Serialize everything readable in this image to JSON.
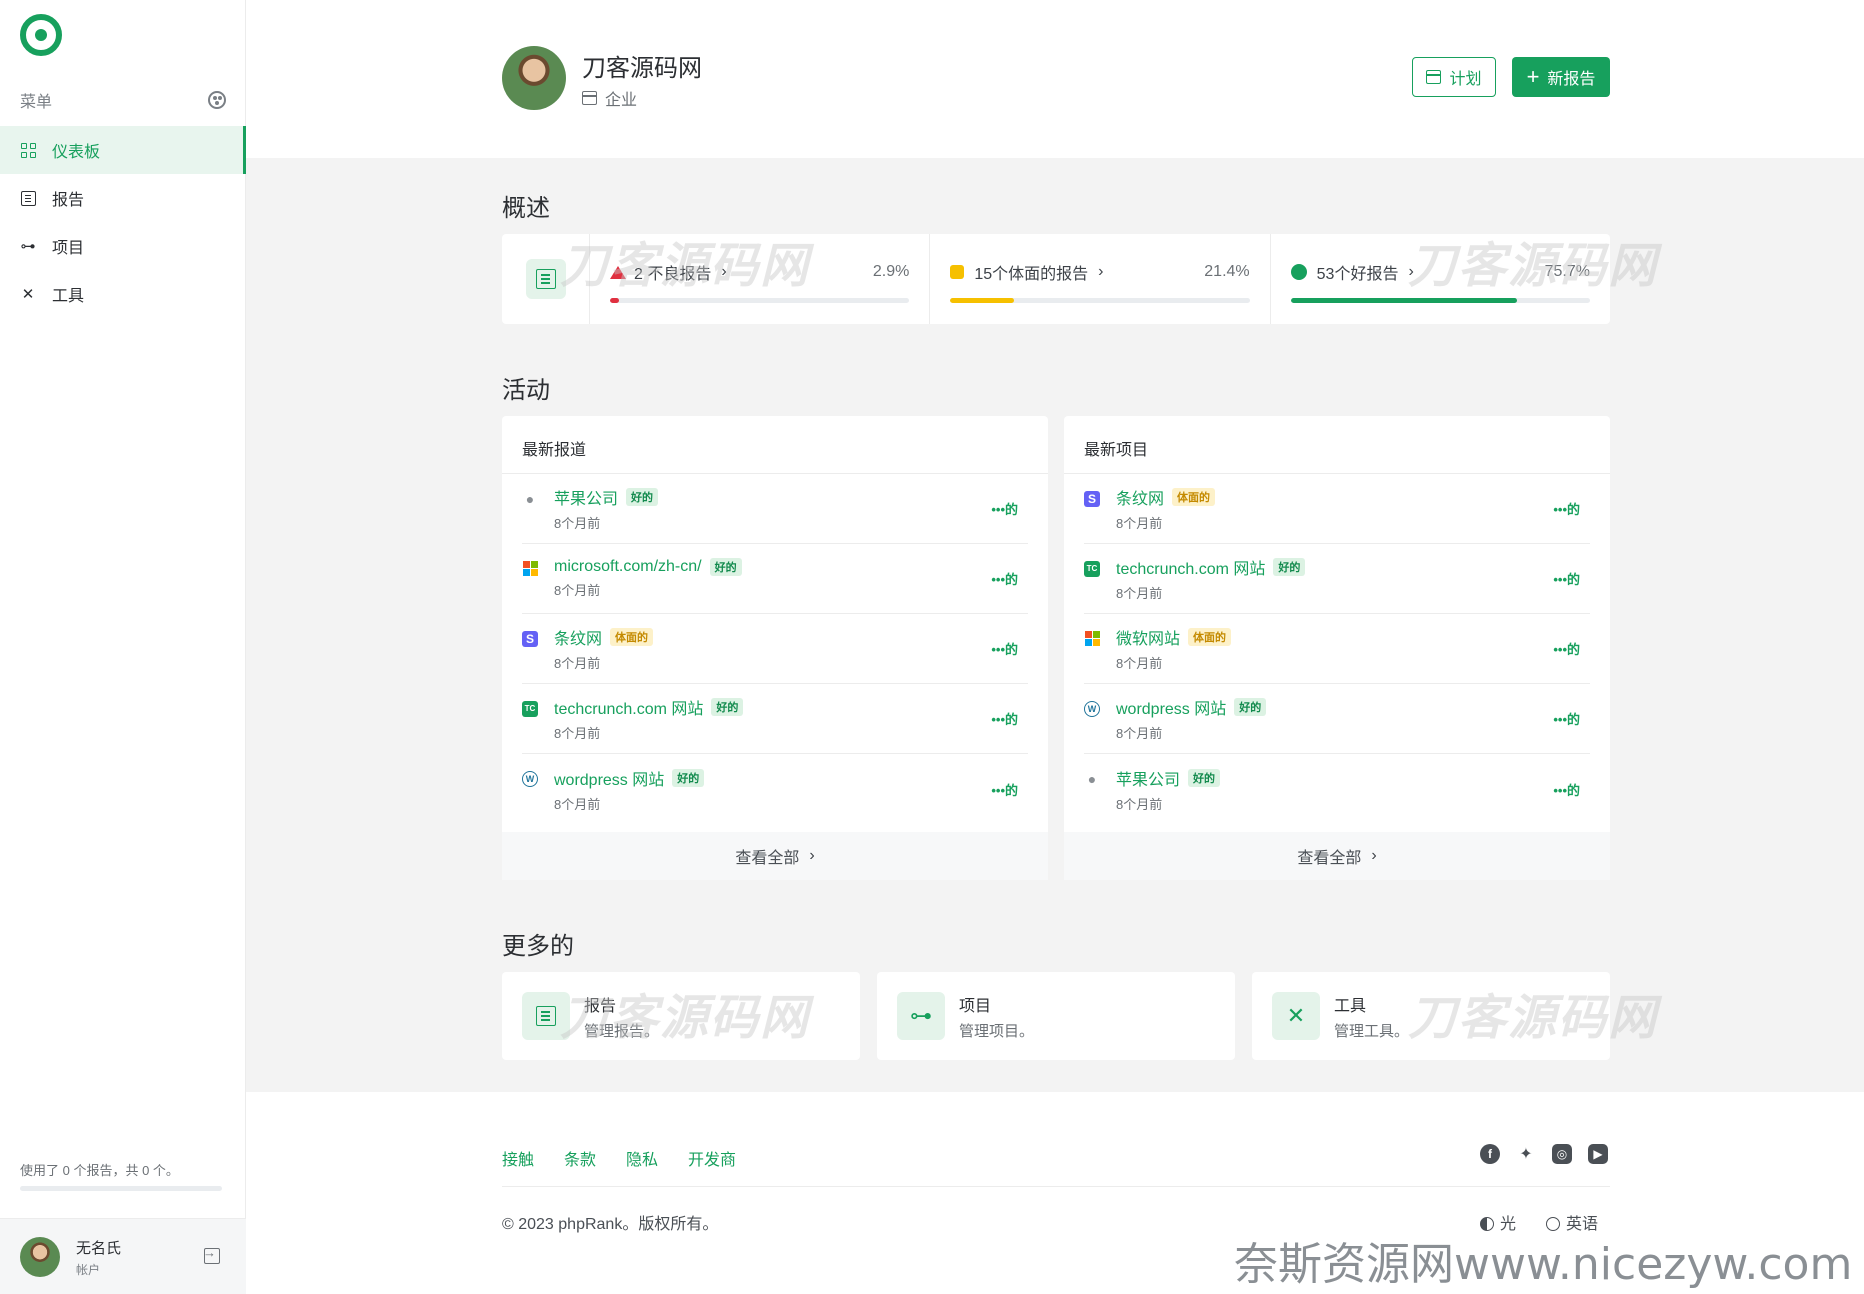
{
  "sidebar": {
    "menu_label": "菜单",
    "items": [
      {
        "label": "仪表板",
        "active": true,
        "icon": "dashboard-icon"
      },
      {
        "label": "报告",
        "active": false,
        "icon": "reports-icon"
      },
      {
        "label": "项目",
        "active": false,
        "icon": "projects-icon"
      },
      {
        "label": "工具",
        "active": false,
        "icon": "tools-icon"
      }
    ],
    "usage_text": "使用了 0 个报告，共 0 个。",
    "usage_fraction": 0,
    "user": {
      "name": "无名氏",
      "sub": "帐户"
    }
  },
  "header": {
    "org_name": "刀客源码网",
    "org_type": "企业",
    "plan_button": "计划",
    "new_report_button": "新报告"
  },
  "overview": {
    "title": "概述",
    "stats": [
      {
        "label": "2 不良报告",
        "pct": "2.9%",
        "value": 2.9,
        "color": "#e03040",
        "marker": "triangle"
      },
      {
        "label": "15个体面的报告",
        "pct": "21.4%",
        "value": 21.4,
        "color": "#f6c000",
        "marker": "square"
      },
      {
        "label": "53个好报告",
        "pct": "75.7%",
        "value": 75.7,
        "color": "#17a05d",
        "marker": "circle"
      }
    ]
  },
  "activity": {
    "title": "活动",
    "latest_reports": {
      "title": "最新报道",
      "rows": [
        {
          "name": "苹果公司",
          "badge": "好的",
          "badge_type": "good",
          "time": "8个月前",
          "icon": "apple-icon",
          "more": "•••的"
        },
        {
          "name": "microsoft.com/zh-cn/",
          "badge": "好的",
          "badge_type": "good",
          "time": "8个月前",
          "icon": "microsoft-icon",
          "more": "•••的"
        },
        {
          "name": "条纹网",
          "badge": "体面的",
          "badge_type": "ok",
          "time": "8个月前",
          "icon": "stripe-icon",
          "more": "•••的"
        },
        {
          "name": "techcrunch.com 网站",
          "badge": "好的",
          "badge_type": "good",
          "time": "8个月前",
          "icon": "techcrunch-icon",
          "more": "•••的"
        },
        {
          "name": "wordpress 网站",
          "badge": "好的",
          "badge_type": "good",
          "time": "8个月前",
          "icon": "wordpress-icon",
          "more": "•••的"
        }
      ],
      "view_all": "查看全部"
    },
    "latest_projects": {
      "title": "最新项目",
      "rows": [
        {
          "name": "条纹网",
          "badge": "体面的",
          "badge_type": "ok",
          "time": "8个月前",
          "icon": "stripe-icon",
          "more": "•••的"
        },
        {
          "name": "techcrunch.com 网站",
          "badge": "好的",
          "badge_type": "good",
          "time": "8个月前",
          "icon": "techcrunch-icon",
          "more": "•••的"
        },
        {
          "name": "微软网站",
          "badge": "体面的",
          "badge_type": "ok",
          "time": "8个月前",
          "icon": "microsoft-icon",
          "more": "•••的"
        },
        {
          "name": "wordpress 网站",
          "badge": "好的",
          "badge_type": "good",
          "time": "8个月前",
          "icon": "wordpress-icon",
          "more": "•••的"
        },
        {
          "name": "苹果公司",
          "badge": "好的",
          "badge_type": "good",
          "time": "8个月前",
          "icon": "apple-icon",
          "more": "•••的"
        }
      ],
      "view_all": "查看全部"
    }
  },
  "more": {
    "title": "更多的",
    "cards": [
      {
        "title": "报告",
        "sub": "管理报告。",
        "icon": "reports-icon"
      },
      {
        "title": "项目",
        "sub": "管理项目。",
        "icon": "projects-icon"
      },
      {
        "title": "工具",
        "sub": "管理工具。",
        "icon": "tools-icon"
      }
    ]
  },
  "footer": {
    "links": [
      "接触",
      "条款",
      "隐私",
      "开发商"
    ],
    "socials": [
      "facebook-icon",
      "twitter-icon",
      "instagram-icon",
      "youtube-icon"
    ],
    "copyright": "© 2023 phpRank。版权所有。",
    "theme": "光",
    "language": "英语"
  },
  "watermarks": {
    "brand": "刀客源码网",
    "site": "奈斯资源网www.nicezyw.com"
  },
  "colors": {
    "accent": "#17a05d",
    "bad": "#e03040",
    "decent": "#f6c000",
    "good": "#17a05d"
  }
}
